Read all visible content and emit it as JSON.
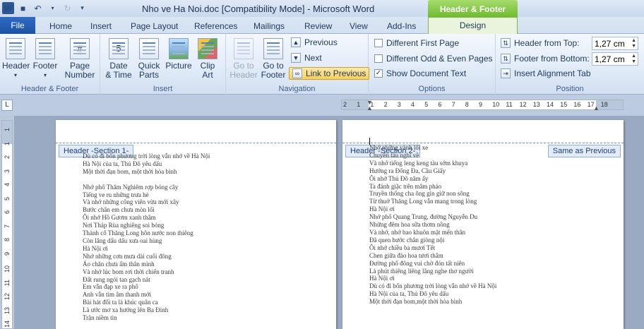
{
  "window": {
    "title": "Nho ve Ha Noi.doc [Compatibility Mode]  -  Microsoft Word",
    "contextual_tools": "Header & Footer Tools"
  },
  "tabs": {
    "file": "File",
    "items": [
      "Home",
      "Insert",
      "Page Layout",
      "References",
      "Mailings",
      "Review",
      "View",
      "Add-Ins"
    ],
    "design": "Design"
  },
  "ribbon": {
    "hf_group": {
      "label": "Header & Footer",
      "header": "Header",
      "footer": "Footer",
      "page_number_1": "Page",
      "page_number_2": "Number"
    },
    "insert_group": {
      "label": "Insert",
      "date_time_1": "Date",
      "date_time_2": "& Time",
      "quick_parts_1": "Quick",
      "quick_parts_2": "Parts",
      "picture": "Picture",
      "clip_art_1": "Clip",
      "clip_art_2": "Art"
    },
    "navigation_group": {
      "label": "Navigation",
      "go_to_header_1": "Go to",
      "go_to_header_2": "Header",
      "go_to_footer_1": "Go to",
      "go_to_footer_2": "Footer",
      "previous": "Previous",
      "next": "Next",
      "link_to_previous": "Link to Previous"
    },
    "options_group": {
      "label": "Options",
      "different_first_page": "Different First Page",
      "different_odd_even": "Different Odd & Even Pages",
      "show_document_text": "Show Document Text"
    },
    "position_group": {
      "label": "Position",
      "header_from_top": "Header from Top:",
      "header_from_top_value": "1,27 cm",
      "footer_from_bottom": "Footer from Bottom:",
      "footer_from_bottom_value": "1,27 cm",
      "insert_alignment_tab": "Insert Alignment Tab"
    }
  },
  "ruler": {
    "h_numbers": [
      "2",
      "1",
      "1",
      "2",
      "3",
      "4",
      "5",
      "6",
      "7",
      "8",
      "9",
      "10",
      "11",
      "12",
      "13",
      "14",
      "15",
      "16",
      "17",
      "18"
    ],
    "v_numbers": [
      "1",
      "1",
      "2",
      "3",
      "4",
      "5",
      "6",
      "7",
      "8",
      "9",
      "10",
      "11",
      "12",
      "13",
      "14"
    ]
  },
  "pages": {
    "left": {
      "header_tag": "Header -Section 1-",
      "lines": [
        "Dù có đi bốn phương trời lòng vẫn nhớ về Hà Nội",
        "Hà Nội của ta, Thủ Đô yêu dấu",
        "Một thời đạn bom, một thời hòa bình",
        "",
        "Nhớ phố Thăm Nghiêm rợp bóng cây",
        "Tiếng ve ru những trưa hè",
        "Và nhớ những công viên vừa mới xây",
        "Bước chân em chưa mòn lối",
        "Ôi nhớ Hồ Gươm xanh thẳm",
        "Nơi Tháp Rùa nghiêng soi bóng",
        "Thành cổ Thăng Long hôn nước non thiêng",
        "Còn lắng dấu dấu xưa oai hùng",
        "Hà Nội ơi",
        "Nhớ những cơn mưa dài cuối đông",
        "Áo chăn chưa ấm thân mình",
        "Và nhớ lúc bom rơi thời chiến tranh",
        "Đất rung ngói tan gạch nát",
        "Em vẫn đạp xe ra phố",
        "Anh vẫn tìm âm thanh mới",
        "Bài hát đổi ta là khúc quân ca",
        "Là ước mơ xa hướng lên Ba Đình",
        "Trận niềm tin"
      ]
    },
    "right": {
      "header_tag": "Header -Section 2-",
      "same_as_previous": "Same as Previous",
      "lines": [
        "Nhớ những vành lối xe",
        "Chuyến tàu nghỉ về",
        "Và nhớ tiếng leng keng tàu sớm khuya",
        "Hướng ra Đống Đa, Cầu Giấy",
        "Ôi nhớ Thủ Đô năm ấy",
        "Ta đánh giặc trên mâm pháo",
        "Truyền thống cha ông gìn giữ non sông",
        "Từ thuở Thăng Long vẫn mang trong lòng",
        "Hà Nội ơi",
        "Nhớ phố Quang Trung, đường Nguyễn Du",
        "Những đêm hoa sữa thơm nồng",
        "Và nhớ, nhớ bao khuôn mặt mến thân",
        "Đã quen bước chân giòng nội",
        "Ôi nhớ chiều ba mươi Tết",
        "Chen giữa đào hoa tươi thắm",
        "Đường phố đông vui chờ đón tất niên",
        "Là phút thiêng liêng lắng nghe thơ người",
        "Hà Nội ơi",
        "Dù có đi bốn phương trời lòng vẫn nhớ về Hà Nội",
        "Hà Nội của ta, Thủ Đô yêu dấu",
        "Một thời đạn bom,một thời hòa bình"
      ]
    }
  },
  "colors": {
    "accent_green": "#7fbf3a",
    "file_tab": "#1f56ab",
    "link_active": "#f8cf5a"
  }
}
